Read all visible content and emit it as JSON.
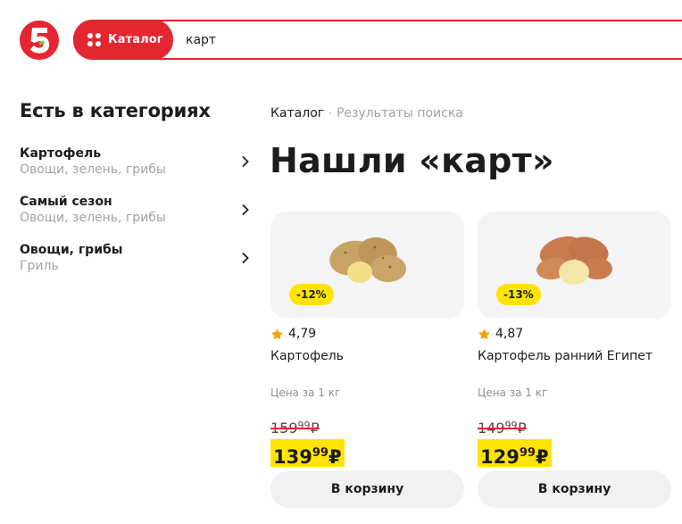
{
  "header": {
    "catalog_label": "Каталог",
    "search": {
      "value": "карт",
      "placeholder": ""
    }
  },
  "sidebar": {
    "title": "Есть в категориях",
    "items": [
      {
        "label": "Картофель",
        "sub": "Овощи, зелень, грибы"
      },
      {
        "label": "Самый сезон",
        "sub": "Овощи, зелень, грибы"
      },
      {
        "label": "Овощи, грибы",
        "sub": "Гриль"
      }
    ]
  },
  "breadcrumb": {
    "root": "Каталог",
    "separator": "·",
    "current": "Результаты поиска"
  },
  "page_title": "Нашли «карт»",
  "products": [
    {
      "discount": "-12%",
      "rating": "4,79",
      "title": "Картофель",
      "unit": "Цена за 1 кг",
      "old_rub": "159",
      "old_kop": "99",
      "new_rub": "139",
      "new_kop": "99",
      "currency": "₽",
      "cart_label": "В корзину"
    },
    {
      "discount": "-13%",
      "rating": "4,87",
      "title": "Картофель ранний Египет",
      "unit": "Цена за 1 кг",
      "old_rub": "149",
      "old_kop": "99",
      "new_rub": "129",
      "new_kop": "99",
      "currency": "₽",
      "cart_label": "В корзину"
    }
  ],
  "colors": {
    "brand_red": "#e3262f",
    "promo_yellow": "#ffe400",
    "star": "#f5a300"
  }
}
